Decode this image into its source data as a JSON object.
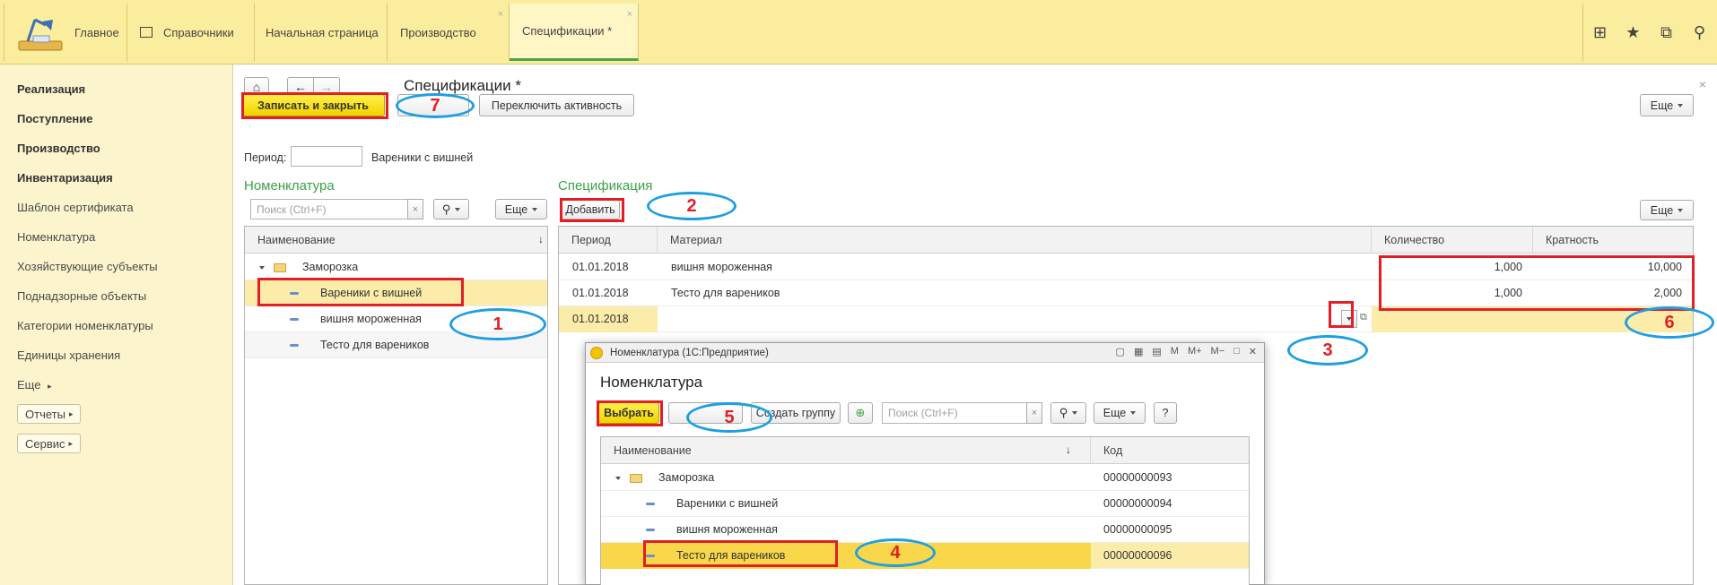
{
  "topbar": {
    "tabs": [
      {
        "label": "Главное"
      },
      {
        "label": "Справочники"
      },
      {
        "label": "Начальная страница"
      },
      {
        "label": "Производство"
      },
      {
        "label": "Спецификации *"
      }
    ]
  },
  "leftnav": {
    "bold_items": [
      "Реализация",
      "Поступление",
      "Производство",
      "Инвентаризация"
    ],
    "items": [
      "Шаблон сертификата",
      "Номенклатура",
      "Хозяйствующие субъекты",
      "Поднадзорные объекты",
      "Категории номенклатуры",
      "Единицы хранения"
    ],
    "more": "Еще",
    "reports": "Отчеты",
    "service": "Сервис"
  },
  "main": {
    "title": "Спецификации *",
    "save_close": "Записать и закрыть",
    "toggle_active": "Переключить активность",
    "more": "Еще",
    "period_label": "Период:",
    "period_value": "",
    "selected_nomenclature": "Вареники с вишней"
  },
  "nomenclature": {
    "title": "Номенклатура",
    "search_placeholder": "Поиск (Ctrl+F)",
    "more": "Еще",
    "col_name": "Наименование",
    "rows": [
      {
        "name": "Заморозка"
      },
      {
        "name": "Вареники с вишней"
      },
      {
        "name": "вишня мороженная"
      },
      {
        "name": "Тесто для вареников"
      }
    ]
  },
  "specification": {
    "title": "Спецификация",
    "add": "Добавить",
    "more": "Еще",
    "columns": [
      "Период",
      "Материал",
      "Количество",
      "Кратность"
    ],
    "rows": [
      {
        "period": "01.01.2018",
        "material": "вишня мороженная",
        "qty": "1,000",
        "mult": "10,000"
      },
      {
        "period": "01.01.2018",
        "material": "Тесто для вареников",
        "qty": "1,000",
        "mult": "2,000"
      },
      {
        "period": "01.01.2018",
        "material": "",
        "qty": "",
        "mult": ""
      }
    ]
  },
  "modal": {
    "window_title": "Номенклатура  (1С:Предприятие)",
    "heading": "Номенклатура",
    "select": "Выбрать",
    "create_group": "Создать группу",
    "search_placeholder": "Поиск (Ctrl+F)",
    "more": "Еще",
    "help": "?",
    "col_name": "Наименование",
    "col_code": "Код",
    "rows": [
      {
        "name": "Заморозка",
        "code": "00000000093"
      },
      {
        "name": "Вареники с вишней",
        "code": "00000000094"
      },
      {
        "name": "вишня мороженная",
        "code": "00000000095"
      },
      {
        "name": "Тесто для вареников",
        "code": "00000000096"
      }
    ]
  },
  "annotations": [
    "1",
    "2",
    "3",
    "4",
    "5",
    "6",
    "7"
  ],
  "colors": {
    "accent_yellow": "#fbed9e",
    "annotation_red": "#e21f26",
    "annotation_blue": "#1f9fe0",
    "title_green": "#3aa247"
  }
}
